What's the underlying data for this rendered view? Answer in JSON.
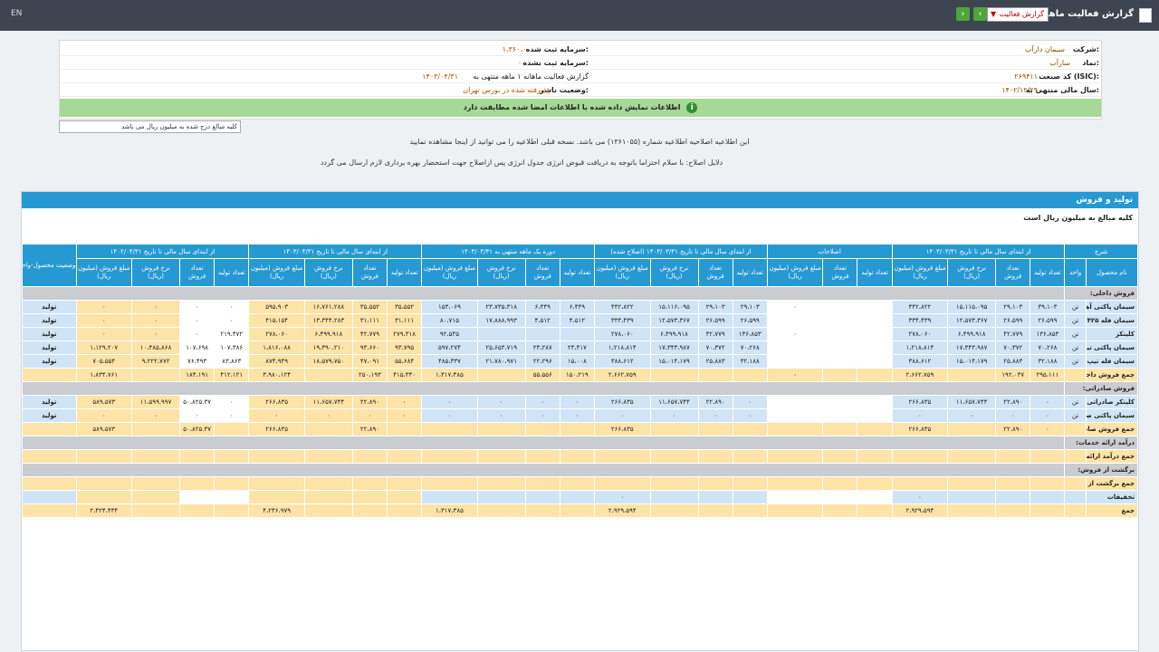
{
  "topbar": {
    "title": "گزارش فعالیت ماهانه",
    "select_value": "گزارش فعالیت",
    "prev_label": "‹",
    "next_label": "›",
    "lang": "EN"
  },
  "info": {
    "company_label": "شرکت:",
    "company_value": "سیمان دارآب",
    "symbol_label": "نماد:",
    "symbol_value": "سارآب",
    "isic_label": "کد صنعت (ISIC):",
    "isic_value": "۲۶۹۴۱۱",
    "fiscal_label": "سال مالی منتهی به:",
    "fiscal_value": "۱۴۰۲/۱۲/۲۹",
    "capital_label": "سرمایه ثبت شده:",
    "capital_value": "۱،۳۶۰،۰۰۰",
    "unregistered_label": "سرمایه ثبت نشده:",
    "unregistered_value": "۰",
    "report_label": "گزارش فعالیت ماهانه ۱ ماهه منتهی به",
    "report_value": "۱۴۰۳/۰۴/۳۱",
    "status_label": "وضعیت ناشر:",
    "status_value": "پذیرفته شده در بورس تهران",
    "green_msg": "اطلاعات نمایش داده شده با اطلاعات امضا شده مطابقت دارد"
  },
  "search_placeholder": "کلیه مبالغ درج شده به میلیون ریال می باشد",
  "notes": {
    "line1": "این اطلاعیه اصلاحیه اطلاعیه شماره (۱۳۶۱۰۵۵) می باشد. نسخه قبلی اطلاعیه را می توانید از اینجا مشاهده نمایید",
    "line2": "دلایل اصلاح: با سلام احتراما باتوجه به دریافت قبوض انرژی جدول انرژی پس ازاصلاح جهت استحضار بهره برداری لازم ارسال می گردد"
  },
  "section": {
    "title": "تولید و فروش",
    "subnote": "کلیه مبالغ به میلیون ریال است"
  },
  "table": {
    "group_headers": [
      "شرح",
      "از ابتدای سال مالی تا تاریخ ۱۴۰۳/۰۳/۳۱",
      "اصلاحات",
      "از ابتدای سال مالی تا تاریخ ۱۴۰۳/۰۳/۳۱ (اصلاح شده)",
      "دوره یک ماهه منتهی به ۱۴۰۳/۰۴/۳۱",
      "از ابتدای سال مالی تا تاریخ ۱۴۰۳/۰۴/۳۱",
      "از ابتدای سال مالی تا تاریخ ۱۴۰۲/۰۴/۳۱",
      "وضعیت محصول-واحد"
    ],
    "sub_headers": [
      "نام محصول",
      "واحد",
      "تعداد تولید",
      "تعداد فروش",
      "نرخ فروش (ریال)",
      "مبلغ فروش (میلیون ریال)",
      "تعداد تولید",
      "تعداد فروش",
      "مبلغ فروش (میلیون ریال)",
      "تعداد تولید",
      "تعداد فروش",
      "نرخ فروش (ریال)",
      "مبلغ فروش (میلیون ریال)",
      "تعداد تولید",
      "تعداد فروش",
      "نرخ فروش (ریال)",
      "مبلغ فروش (میلیون ریال)",
      "تعداد تولید",
      "تعداد فروش",
      "نرخ فروش (ریال)",
      "مبلغ فروش (میلیون ریال)",
      "تعداد تولید",
      "تعداد فروش",
      "نرخ فروش (ریال)",
      "مبلغ فروش (میلیون ریال)",
      ""
    ],
    "rows": [
      {
        "type": "section",
        "cells": [
          "فروش داخلی:"
        ]
      },
      {
        "type": "data",
        "tall": true,
        "cells": [
          "سیمان پاکتی آهکی",
          "تن",
          "۳۹،۱۰۳",
          "۲۹،۱۰۳",
          "۱۵،۱۱۵،۰۹۵",
          "۴۴۲،۸۲۲",
          "",
          "",
          "۰",
          "۲۹،۱۰۳",
          "۲۹،۱۰۳",
          "۱۵،۱۱۶،۰۹۵",
          "۴۴۲،۸۲۲",
          "۶،۴۴۹",
          "۶،۴۴۹",
          "۲۳،۷۳۵،۳۱۸",
          "۱۵۳،۰۶۹",
          "۳۵،۵۵۲",
          "۳۵،۵۵۲",
          "۱۶،۷۶۱،۲۸۸",
          "۵۹۵،۹۰۳",
          "۰",
          "۰",
          "۰",
          "۰",
          "تولید"
        ]
      },
      {
        "type": "data",
        "tall": true,
        "cells": [
          "سیمان فله ۱.۴۲۵",
          "تن",
          "۲۶،۵۹۹",
          "۲۶،۵۹۹",
          "۱۲،۵۷۳،۳۶۷",
          "۳۳۴،۴۳۹",
          "",
          "",
          "",
          "۲۶،۵۹۹",
          "۲۶،۵۹۹",
          "۱۲،۵۷۳،۳۶۷",
          "۳۳۴،۴۳۹",
          "۴،۵۱۲",
          "۴،۵۱۲",
          "۱۷،۸۸۸،۹۹۳",
          "۸۰،۷۱۵",
          "۳۱،۱۱۱",
          "۳۱،۱۱۱",
          "۱۳،۳۴۴،۲۸۳",
          "۴۱۵،۱۵۴",
          "۰",
          "۰",
          "۰",
          "۰",
          "تولید"
        ]
      },
      {
        "type": "data",
        "cells": [
          "کلینکر",
          "تن",
          "۱۳۶،۸۵۳",
          "۴۲،۷۷۹",
          "۶،۴۹۹،۹۱۸",
          "۲۷۸،۰۶۰",
          "",
          "",
          "۰",
          "۱۳۶،۸۵۳",
          "۴۲،۷۷۹",
          "۶،۴۹۹،۹۱۸",
          "۲۷۸،۰۶۰",
          "",
          "",
          "",
          "۹۲،۵۳۵",
          "۲۷۹،۳۱۸",
          "۴۲،۷۷۹",
          "۶،۴۹۹،۹۱۸",
          "۲۷۸،۰۶۰",
          "۲۱۹،۴۷۲",
          "۰",
          "۰",
          "۰",
          "تولید"
        ]
      },
      {
        "type": "data",
        "tall": true,
        "cells": [
          "سیمان پاکتی تیپ ۲",
          "تن",
          "۷۰،۲۶۸",
          "۷۰،۳۷۲",
          "۱۷،۳۴۳،۹۸۷",
          "۱،۲۱۸،۸۱۴",
          "",
          "",
          "",
          "۷۰،۲۶۸",
          "۷۰،۳۷۲",
          "۱۷،۳۴۳،۹۸۷",
          "۱،۲۱۸،۸۱۴",
          "۲۳،۴۱۷",
          "۲۳،۲۸۷",
          "۲۵،۶۵۳،۷۱۹",
          "۵۹۷،۲۷۴",
          "۹۳،۷۹۵",
          "۹۳،۶۶۰",
          "۱۹،۳۹۰،۲۱۰",
          "۱،۸۱۶،۰۸۸",
          "۱۰۷،۳۸۶",
          "۱۰۷،۶۹۸",
          "۱۰،۴۸۵،۸۶۸",
          "۱،۱۲۹،۲۰۷",
          "تولید"
        ]
      },
      {
        "type": "data",
        "tall": true,
        "cells": [
          "سیمان فله تیپ ۲",
          "تن",
          "۳۲،۱۸۸",
          "۲۵،۸۸۳",
          "۱۵،۰۱۴،۱۷۹",
          "۳۸۸،۶۱۲",
          "",
          "",
          "",
          "۳۲،۱۸۸",
          "۲۵،۸۸۳",
          "۱۵،۰۱۴،۱۷۹",
          "۳۸۸،۶۱۲",
          "۱۵،۰۰۸",
          "۲۲،۲۹۶",
          "۲۱،۷۸۰،۹۷۱",
          "۴۸۵،۳۳۷",
          "۵۵،۶۸۴",
          "۴۷،۰۹۱",
          "۱۸،۵۷۹،۷۵۰",
          "۸۷۴،۹۴۹",
          "۸۳،۸۶۳",
          "۷۶،۴۹۳",
          "۹،۲۲۲،۷۷۲",
          "۷۰۵،۵۵۴",
          "تولید"
        ]
      },
      {
        "type": "total",
        "tall": true,
        "cells": [
          "جمع فروش داخلی",
          "",
          "۲۹۵،۱۱۱",
          "۱۹۲،۰۳۷",
          "",
          "۲،۶۶۲،۷۵۹",
          "",
          "",
          "۰",
          "",
          "",
          "",
          "۲،۶۶۲،۷۵۹",
          "۱۵۰،۲۱۹",
          "۵۵،۵۵۶",
          "",
          "۱،۳۱۷،۳۸۵",
          "۴۱۵،۳۳۰",
          "۲۵۰،۱۹۳",
          "",
          "۳،۹۸۰،۱۲۴",
          "۴۱۲،۱۲۱",
          "۱۸۴،۱۹۱",
          "",
          "۱،۸۳۴،۷۶۱",
          ""
        ]
      },
      {
        "type": "section",
        "cells": [
          "فروش صادراتی:"
        ]
      },
      {
        "type": "data",
        "cells": [
          "کلینکر صادراتی",
          "تن",
          "۰",
          "۲۲،۸۹۰",
          "۱۱،۶۵۷،۷۴۴",
          "۲۶۶،۸۳۵",
          "",
          "",
          "",
          "۰",
          "۲۲،۸۹۰",
          "۱۱،۶۵۷،۷۴۴",
          "۲۶۶،۸۳۵",
          "۰",
          "۰",
          "۰",
          "۰",
          "۰",
          "۲۲،۸۹۰",
          "۱۱،۶۵۷،۷۴۴",
          "۲۶۶،۸۳۵",
          "۰",
          "۵۰،۸۲۵.۳۷",
          "۱۱،۵۹۹.۹۹۷",
          "۵۸۹،۵۷۳",
          "تولید"
        ]
      },
      {
        "type": "data",
        "tall": true,
        "cells": [
          "سیمان پاکتی صادراتی",
          "تن",
          "۰",
          "۰",
          "۰",
          "۰",
          "",
          "",
          "",
          "۰",
          "۰",
          "۰",
          "۰",
          "۰",
          "۰",
          "۰",
          "۰",
          "۰",
          "۰",
          "۰",
          "۰",
          "۰",
          "۰",
          "۰",
          "۰",
          "تولید"
        ]
      },
      {
        "type": "total",
        "tall": true,
        "cells": [
          "جمع فروش صادراتی",
          "",
          "۰",
          "۲۲،۸۹۰",
          "",
          "۲۶۶،۸۳۵",
          "",
          "",
          "",
          "",
          "",
          "",
          "۲۶۶،۸۳۵",
          "",
          "",
          "",
          "",
          "",
          "۲۲،۸۹۰",
          "",
          "۲۶۶،۸۳۵",
          "",
          "۵۰،۸۲۵.۳۷",
          "",
          "۵۸۹،۵۷۳",
          ""
        ]
      },
      {
        "type": "section",
        "tall": true,
        "cells": [
          "درآمد ارائه خدمات:"
        ]
      },
      {
        "type": "total",
        "tall": true,
        "cells": [
          "جمع درآمد ارائه خدمات",
          "",
          "",
          "",
          "",
          "",
          "",
          "",
          "",
          "",
          "",
          "",
          "",
          "",
          "",
          "",
          "",
          "",
          "",
          "",
          "",
          "",
          "",
          "",
          "",
          ""
        ]
      },
      {
        "type": "section",
        "tall": true,
        "cells": [
          "برگشت از فروش:"
        ]
      },
      {
        "type": "total",
        "tall": true,
        "cells": [
          "جمع برگشت از فروش",
          "",
          "",
          "",
          "",
          "",
          "",
          "",
          "",
          "",
          "",
          "",
          "",
          "",
          "",
          "",
          "",
          "",
          "",
          "",
          "",
          "",
          "",
          "",
          "",
          ""
        ]
      },
      {
        "type": "data",
        "cells": [
          "تخفیفات",
          "",
          "",
          "",
          "",
          "۰",
          "",
          "",
          "",
          "",
          "",
          "",
          "۰",
          "",
          "",
          "",
          "",
          "",
          "",
          "",
          "",
          "",
          "",
          "",
          "",
          ""
        ]
      },
      {
        "type": "total",
        "cells": [
          "جمع",
          "",
          "",
          "",
          "",
          "۲،۹۲۹،۵۹۴",
          "",
          "",
          "",
          "",
          "",
          "",
          "۲،۹۲۹،۵۹۴",
          "",
          "",
          "",
          "۱،۳۱۷،۳۸۵",
          "",
          "",
          "",
          "۴،۲۴۶،۹۷۹",
          "",
          "",
          "",
          "۲،۴۲۴،۴۳۴",
          ""
        ]
      }
    ]
  }
}
